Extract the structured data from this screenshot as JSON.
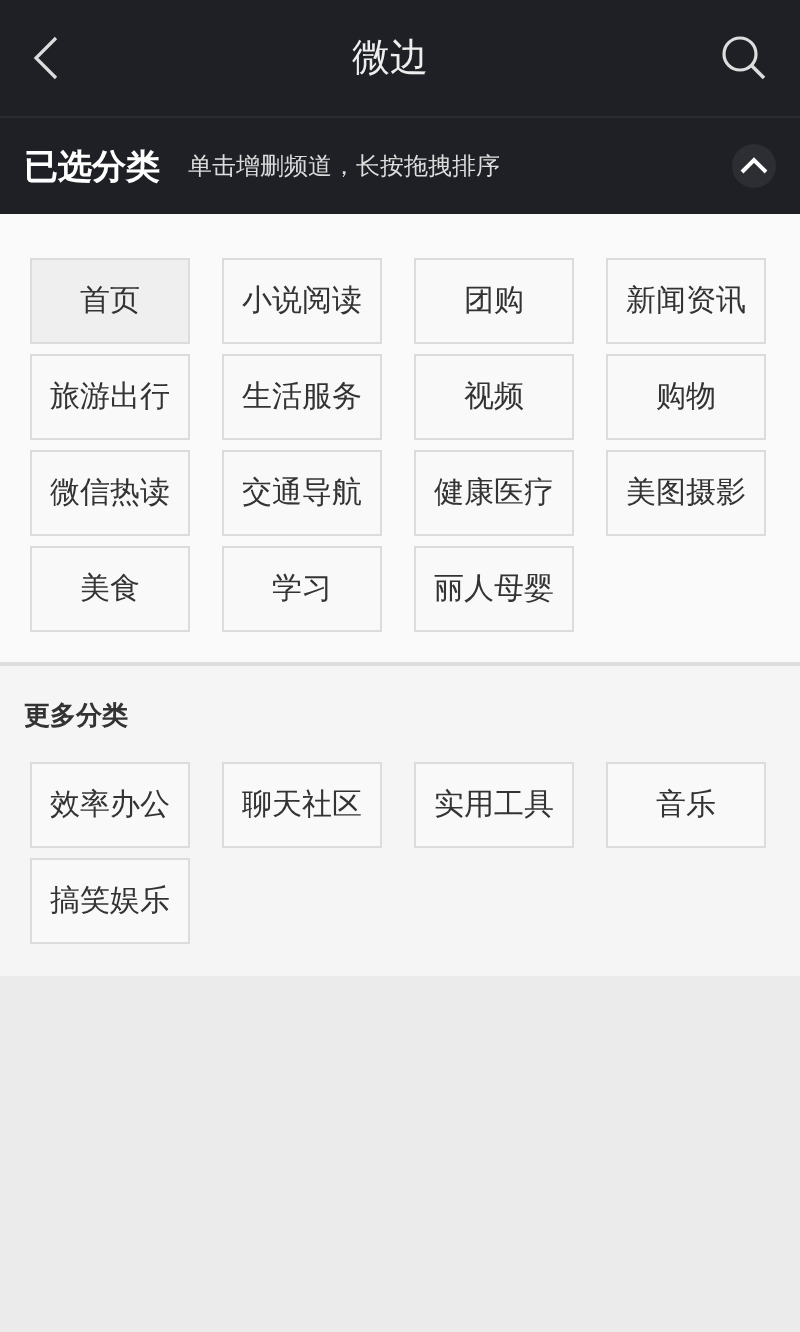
{
  "header": {
    "title": "微边"
  },
  "selected_section": {
    "title": "已选分类",
    "hint": "单击增删频道，长按拖拽排序",
    "expanded": true
  },
  "selected_channels": [
    {
      "label": "首页",
      "selected": true
    },
    {
      "label": "小说阅读",
      "selected": false
    },
    {
      "label": "团购",
      "selected": false
    },
    {
      "label": "新闻资讯",
      "selected": false
    },
    {
      "label": "旅游出行",
      "selected": false
    },
    {
      "label": "生活服务",
      "selected": false
    },
    {
      "label": "视频",
      "selected": false
    },
    {
      "label": "购物",
      "selected": false
    },
    {
      "label": "微信热读",
      "selected": false
    },
    {
      "label": "交通导航",
      "selected": false
    },
    {
      "label": "健康医疗",
      "selected": false
    },
    {
      "label": "美图摄影",
      "selected": false
    },
    {
      "label": "美食",
      "selected": false
    },
    {
      "label": "学习",
      "selected": false
    },
    {
      "label": "丽人母婴",
      "selected": false
    }
  ],
  "more_section": {
    "title": "更多分类"
  },
  "more_channels": [
    {
      "label": "效率办公"
    },
    {
      "label": "聊天社区"
    },
    {
      "label": "实用工具"
    },
    {
      "label": "音乐"
    },
    {
      "label": "搞笑娱乐"
    }
  ]
}
